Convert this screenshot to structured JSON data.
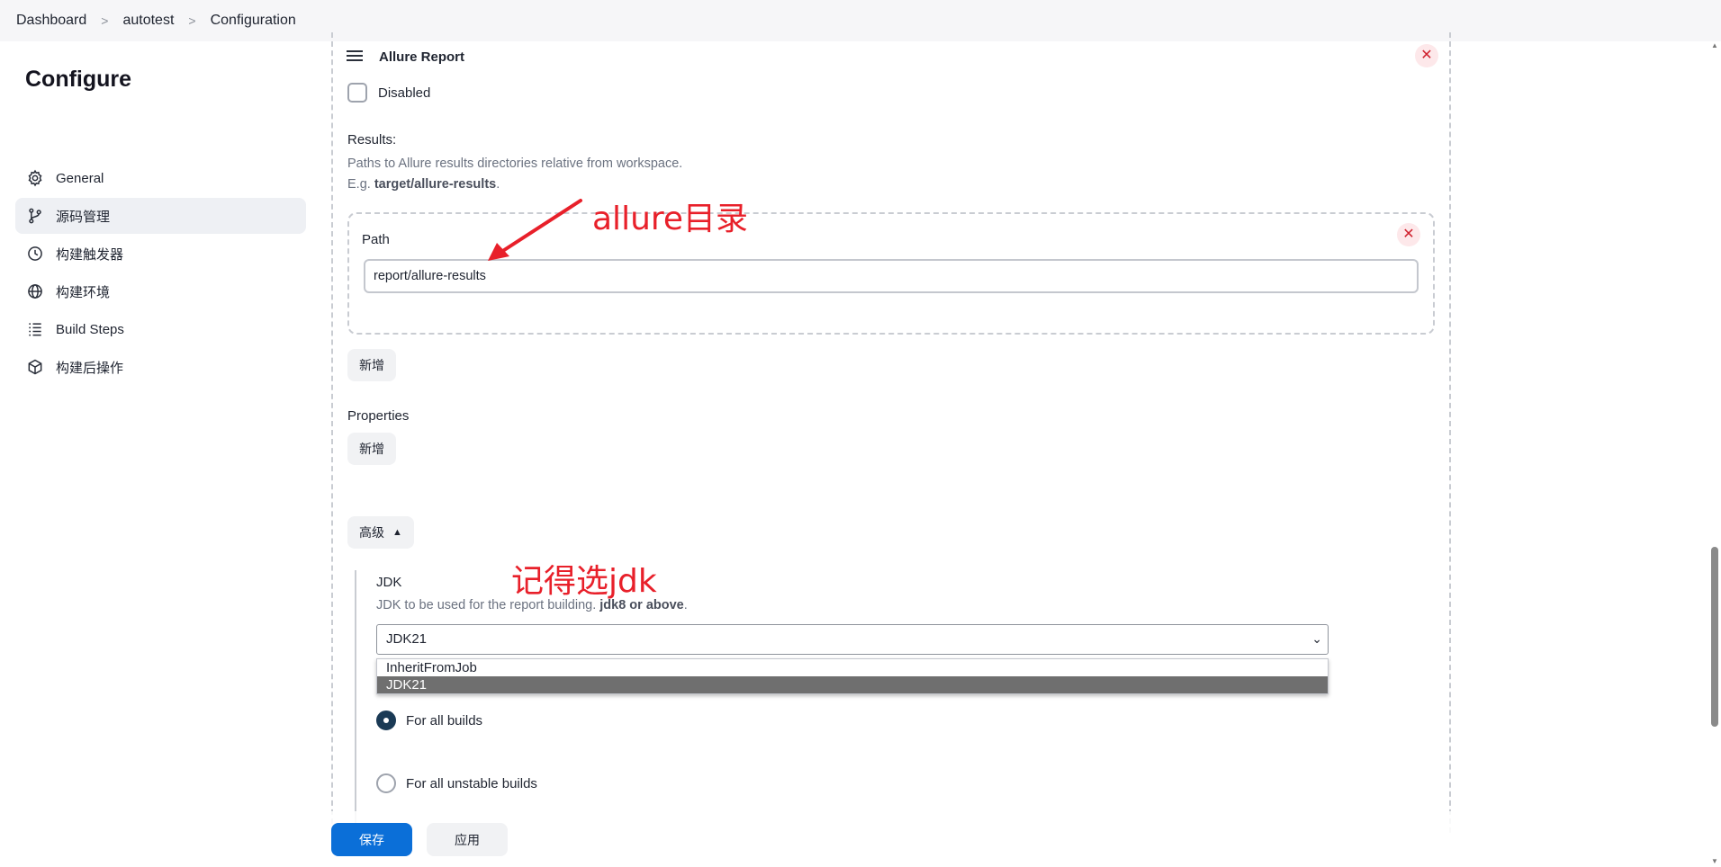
{
  "breadcrumb": {
    "items": [
      "Dashboard",
      "autotest",
      "Configuration"
    ],
    "separator": ">"
  },
  "sidebar": {
    "title": "Configure",
    "items": [
      {
        "label": "General",
        "icon": "gear-icon"
      },
      {
        "label": "源码管理",
        "icon": "git-branch-icon",
        "active": true
      },
      {
        "label": "构建触发器",
        "icon": "clock-icon"
      },
      {
        "label": "构建环境",
        "icon": "globe-icon"
      },
      {
        "label": "Build Steps",
        "icon": "list-icon"
      },
      {
        "label": "构建后操作",
        "icon": "cube-icon"
      }
    ]
  },
  "allure_section": {
    "title": "Allure Report",
    "disabled_label": "Disabled",
    "results_label": "Results:",
    "results_help": "Paths to Allure results directories relative from workspace.",
    "results_example_prefix": "E.g.",
    "results_example_value": "target/allure-results",
    "results_example_suffix": ".",
    "path_label": "Path",
    "path_value": "report/allure-results",
    "add_path_label": "新增",
    "properties_label": "Properties",
    "add_property_label": "新增",
    "advanced_label": "高级",
    "jdk_label": "JDK",
    "jdk_help": "JDK to be used for the report building.",
    "jdk_help_bold": "jdk8 or above",
    "jdk_help_suffix": ".",
    "jdk_selected": "JDK21",
    "jdk_options": [
      "InheritFromJob",
      "JDK21"
    ],
    "radio_all_builds": "For all builds",
    "radio_unstable_builds": "For all unstable builds"
  },
  "annotations": {
    "allure_dir": "allure目录",
    "remember_jdk": "记得选jdk"
  },
  "footer": {
    "save_label": "保存",
    "apply_label": "应用"
  },
  "colors": {
    "primary": "#0b6fd8",
    "annotation": "#e8202a",
    "close": "#d0222f"
  }
}
